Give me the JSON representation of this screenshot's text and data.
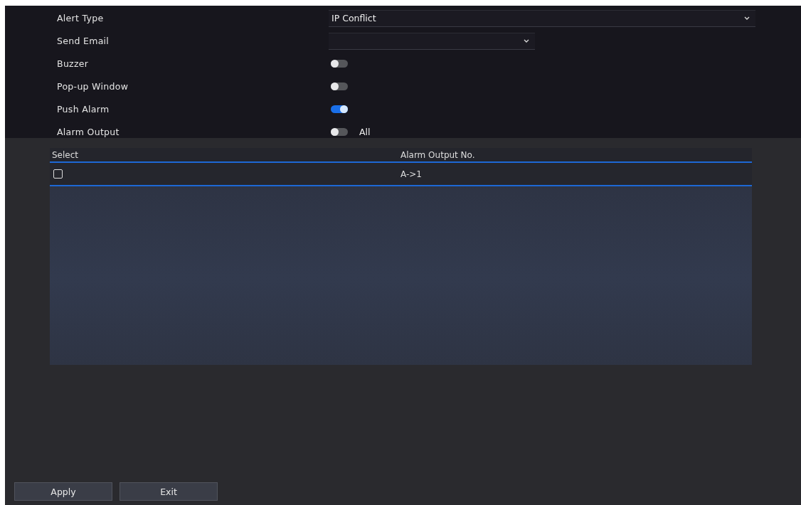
{
  "form": {
    "rows": [
      {
        "kind": "dropdown",
        "label": "Alert Type",
        "value": "IP Conflict"
      },
      {
        "kind": "dropdown",
        "label": "Send Email"
      },
      {
        "kind": "toggle",
        "label": "Buzzer",
        "on": false
      },
      {
        "kind": "toggle",
        "label": "Pop-up Window",
        "on": false
      },
      {
        "kind": "toggle",
        "label": "Push Alarm",
        "on": true
      },
      {
        "kind": "toggle",
        "label": "Alarm Output",
        "on": false,
        "toggle_label": "All"
      }
    ]
  },
  "table": {
    "columns": [
      "Select",
      "Alarm Output No."
    ],
    "rows": [
      {
        "cells": [
          {
            "kind": "checkbox",
            "checked": false
          },
          {
            "kind": "text",
            "text": "A->1"
          }
        ]
      }
    ]
  },
  "buttons": [
    "Apply",
    "Exit"
  ]
}
